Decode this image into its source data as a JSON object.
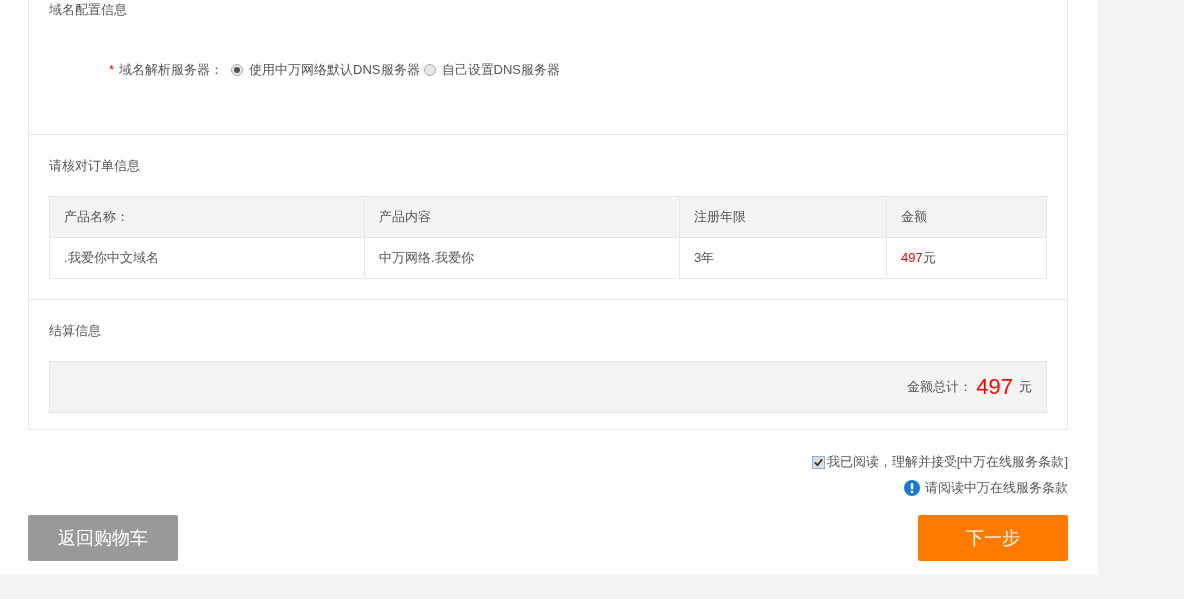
{
  "dns_section": {
    "title": "域名配置信息",
    "field_label": "域名解析服务器：",
    "required_mark": "*",
    "options": [
      {
        "label": "使用中万网络默认DNS服务器",
        "selected": true
      },
      {
        "label": "自己设置DNS服务器",
        "selected": false
      }
    ]
  },
  "order_section": {
    "title": "请核对订单信息",
    "columns": [
      "产品名称：",
      "产品内容",
      "注册年限",
      "金额"
    ],
    "rows": [
      {
        "name": ".我爱你中文域名",
        "content": "中万网络.我爱你",
        "years": "3年",
        "amount": "497",
        "unit": "元"
      }
    ]
  },
  "settlement_section": {
    "title": "结算信息",
    "total_label": "金额总计：",
    "total": "497",
    "unit": "元"
  },
  "agreement": {
    "checked": true,
    "label": "我已阅读，理解并接受[中万在线服务条款]"
  },
  "notice": "请阅读中万在线服务条款",
  "buttons": {
    "back": "返回购物车",
    "next": "下一步"
  }
}
